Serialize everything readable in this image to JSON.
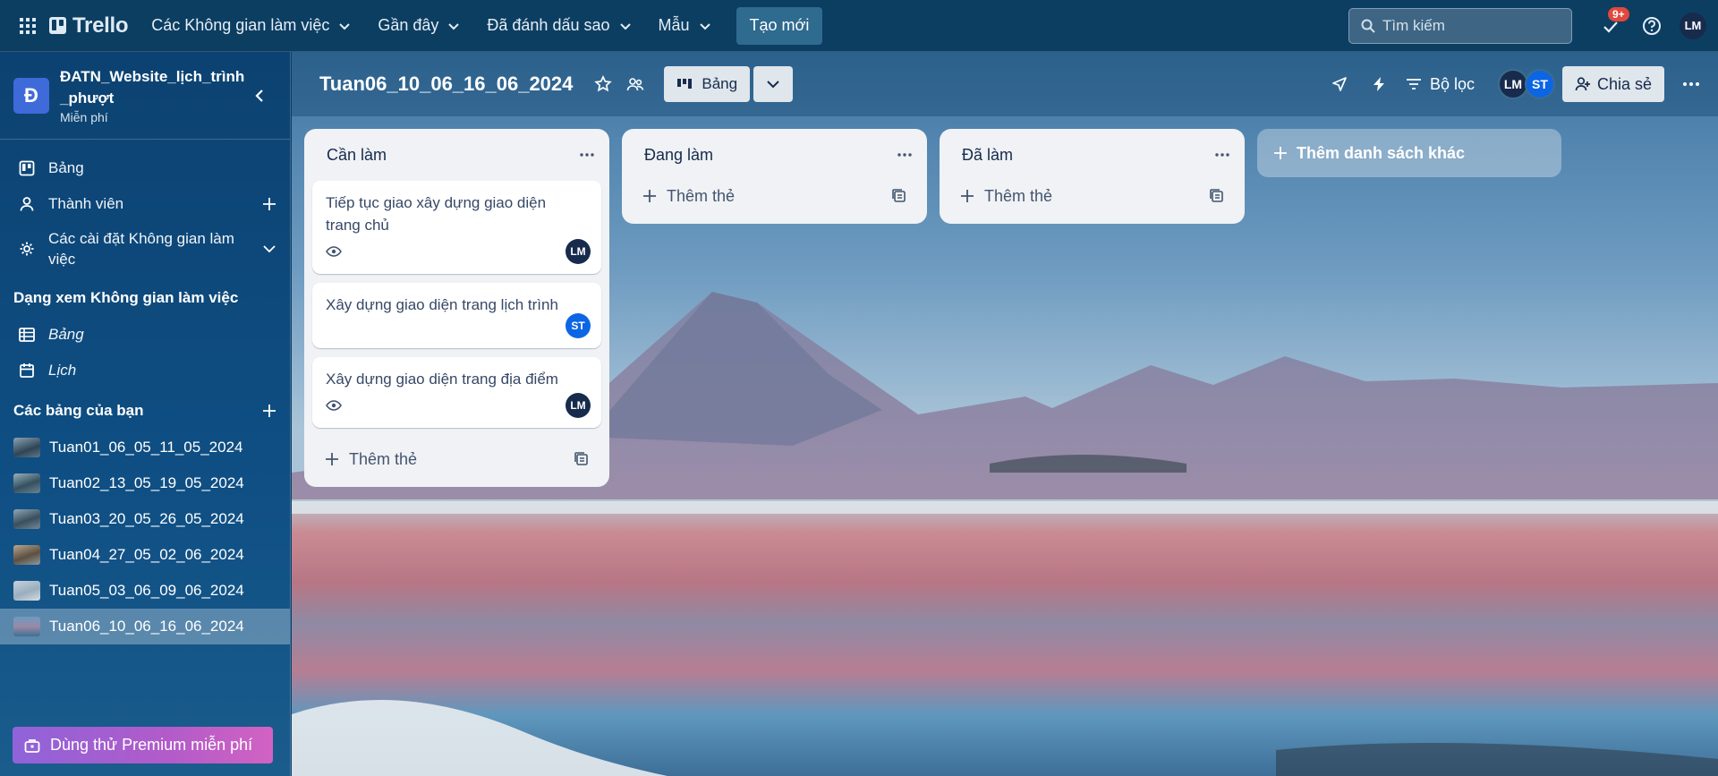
{
  "topbar": {
    "app_name": "Trello",
    "nav": [
      {
        "label": "Các Không gian làm việc"
      },
      {
        "label": "Gần đây"
      },
      {
        "label": "Đã đánh dấu sao"
      },
      {
        "label": "Mẫu"
      }
    ],
    "create_label": "Tạo mới",
    "search_placeholder": "Tìm kiếm",
    "notification_badge": "9+",
    "user_initials": "LM"
  },
  "sidebar": {
    "workspace_initial": "Đ",
    "workspace_name": "ĐATN_Website_lịch_trình _phượt",
    "workspace_plan": "Miễn phí",
    "menu": [
      {
        "label": "Bảng",
        "icon": "board-icon"
      },
      {
        "label": "Thành viên",
        "icon": "person-icon"
      },
      {
        "label": "Các cài đặt Không gian làm việc",
        "icon": "gear-icon"
      }
    ],
    "views_heading": "Dạng xem Không gian làm việc",
    "views": [
      {
        "label": "Bảng",
        "icon": "table-icon"
      },
      {
        "label": "Lịch",
        "icon": "calendar-icon"
      }
    ],
    "boards_heading": "Các bảng của bạn",
    "boards": [
      {
        "label": "Tuan01_06_05_11_05_2024"
      },
      {
        "label": "Tuan02_13_05_19_05_2024"
      },
      {
        "label": "Tuan03_20_05_26_05_2024"
      },
      {
        "label": "Tuan04_27_05_02_06_2024"
      },
      {
        "label": "Tuan05_03_06_09_06_2024"
      },
      {
        "label": "Tuan06_10_06_16_06_2024"
      }
    ],
    "premium_label": "Dùng thử Premium miễn phí"
  },
  "board": {
    "title": "Tuan06_10_06_16_06_2024",
    "view_label": "Bảng",
    "filter_label": "Bộ lọc",
    "members": [
      "LM",
      "ST"
    ],
    "share_label": "Chia sẻ",
    "lists": [
      {
        "title": "Cần làm",
        "cards": [
          {
            "text": "Tiếp tục giao xây dựng giao diện trang chủ",
            "member": "LM"
          },
          {
            "text": "Xây dựng giao diện trang lịch trình",
            "member": "ST"
          },
          {
            "text": "Xây dựng giao diện trang địa điểm",
            "member": "LM"
          }
        ],
        "add_card_label": "Thêm thẻ"
      },
      {
        "title": "Đang làm",
        "cards": [],
        "add_card_label": "Thêm thẻ"
      },
      {
        "title": "Đã làm",
        "cards": [],
        "add_card_label": "Thêm thẻ"
      }
    ],
    "add_list_label": "Thêm danh sách khác"
  },
  "colors": {
    "topbar": "#0c3e62",
    "sidebar": "#0f4f84",
    "list_bg": "#f0f2f5",
    "avatar_lm": "#172b4d",
    "avatar_st": "#0c66e4",
    "premium_start": "#8f63d9",
    "premium_end": "#d262c3"
  }
}
